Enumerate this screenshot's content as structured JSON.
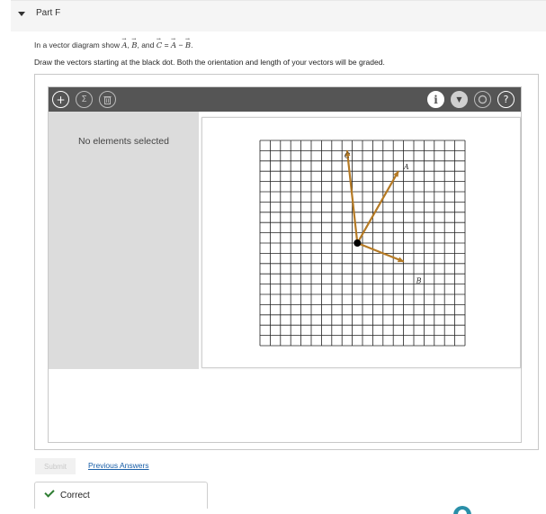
{
  "part": {
    "title": "Part F"
  },
  "question": {
    "prefix": "In a vector diagram show",
    "vecA": "A",
    "vecB": "B",
    "and": "and",
    "vecC": "C",
    "eq": "=",
    "vecA2": "A",
    "minus": "−",
    "vecB2": "B",
    "instructions": "Draw the vectors starting at the black dot. Both the orientation and length of your vectors will be graded."
  },
  "toolbar": {
    "add_icon": "plus-icon",
    "sum_icon": "sigma-icon",
    "delete_icon": "trash-icon",
    "info_icon": "info-icon",
    "chevron_icon": "chevron-down-icon",
    "reset_icon": "reset-icon",
    "help_label": "?"
  },
  "panel": {
    "no_selection": "No elements selected"
  },
  "canvas": {
    "grid_size": 20,
    "origin": [
      9.5,
      10
    ],
    "vectors": [
      {
        "label": "A",
        "end": [
          13.5,
          3
        ],
        "color": "#b57a24"
      },
      {
        "label": "B",
        "end": [
          14,
          11.8
        ],
        "color": "#b57a24"
      },
      {
        "label": "C",
        "end": [
          8.5,
          1
        ],
        "color": "#b57a24"
      }
    ]
  },
  "actions": {
    "submit": "Submit",
    "previous_answers": "Previous Answers"
  },
  "feedback": {
    "status": "Correct"
  },
  "colors": {
    "vector": "#b57a24",
    "link": "#1a5fa8",
    "correct": "#2e7d32",
    "toolbar": "#555555"
  }
}
